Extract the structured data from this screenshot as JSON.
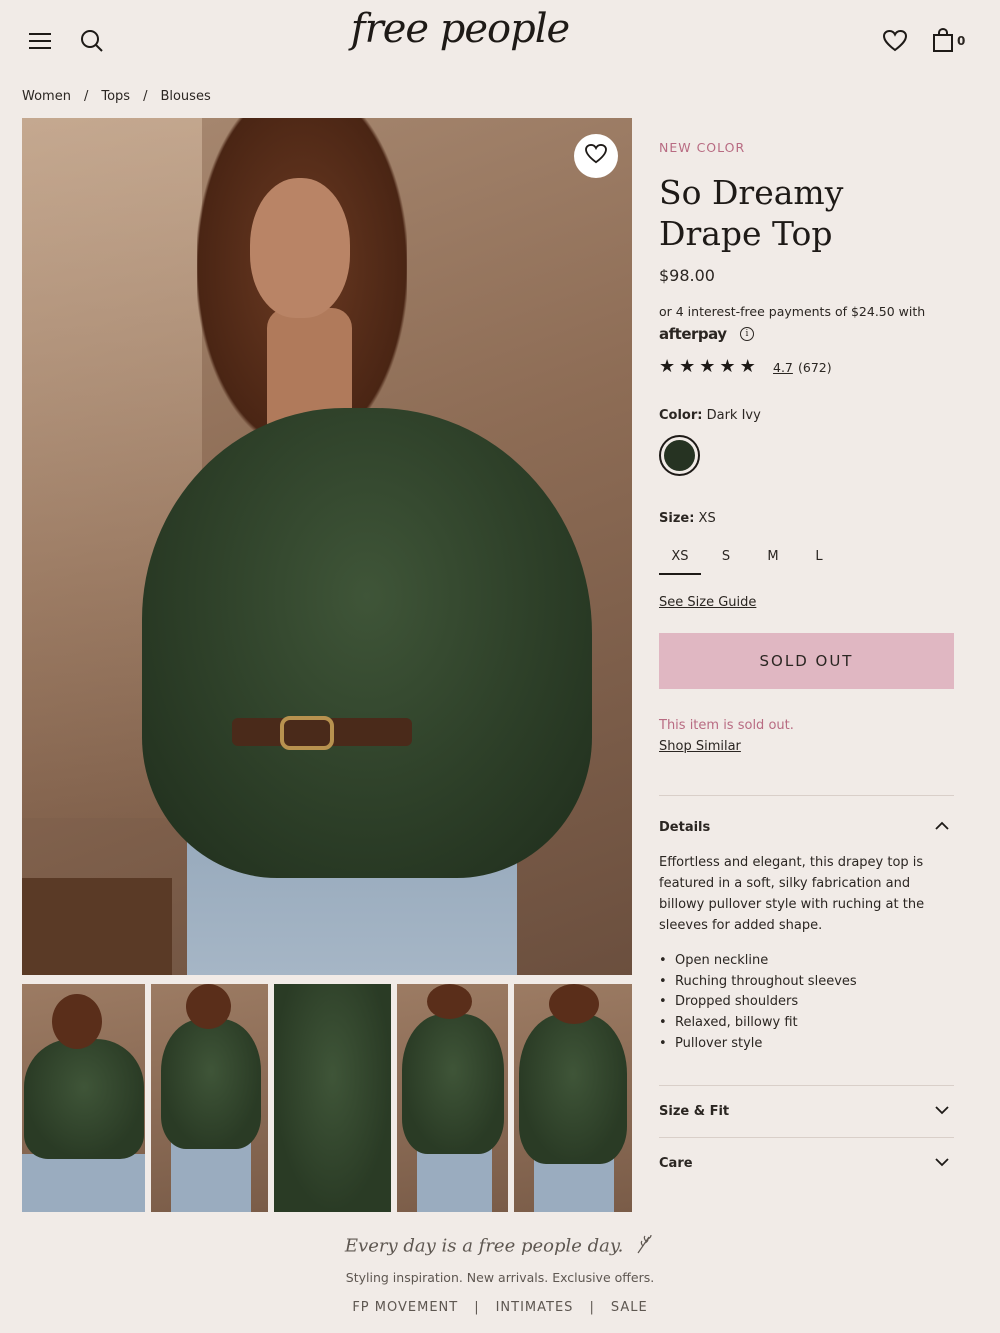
{
  "header": {
    "logo": "free people",
    "cart_count": "0"
  },
  "breadcrumb": [
    "Women",
    "Tops",
    "Blouses"
  ],
  "product": {
    "badge": "NEW COLOR",
    "title": "So Dreamy Drape Top",
    "price": "$98.00",
    "afterpay_text": "or 4 interest-free payments of $24.50 with",
    "afterpay_brand": "afterpay",
    "rating": {
      "stars": 5,
      "value": "4.7",
      "count": "(672)"
    },
    "color": {
      "label": "Color:",
      "value": "Dark Ivy",
      "swatch": "#263322"
    },
    "size": {
      "label": "Size:",
      "value": "XS",
      "options": [
        "XS",
        "S",
        "M",
        "L"
      ]
    },
    "size_guide": "See Size Guide",
    "cta": "SOLD OUT",
    "sold_message": "This item is sold out.",
    "shop_similar": "Shop Similar"
  },
  "accordion": {
    "details": {
      "title": "Details",
      "text": "Effortless and elegant, this drapey top is featured in a soft, silky fabrication and billowy pullover style with ruching at the sleeves for added shape.",
      "bullets": [
        "Open neckline",
        "Ruching throughout sleeves",
        "Dropped shoulders",
        "Relaxed, billowy fit",
        "Pullover style"
      ]
    },
    "size_fit": {
      "title": "Size & Fit"
    },
    "care": {
      "title": "Care"
    }
  },
  "footer": {
    "tagline": "Every day is a free people day.",
    "subline": "Styling inspiration. New arrivals. Exclusive offers.",
    "links": [
      "FP MOVEMENT",
      "INTIMATES",
      "SALE"
    ]
  },
  "colors": {
    "background": "#f1ebe7",
    "accent_pink": "#b86b82",
    "button_pink": "#e0b7c2"
  }
}
